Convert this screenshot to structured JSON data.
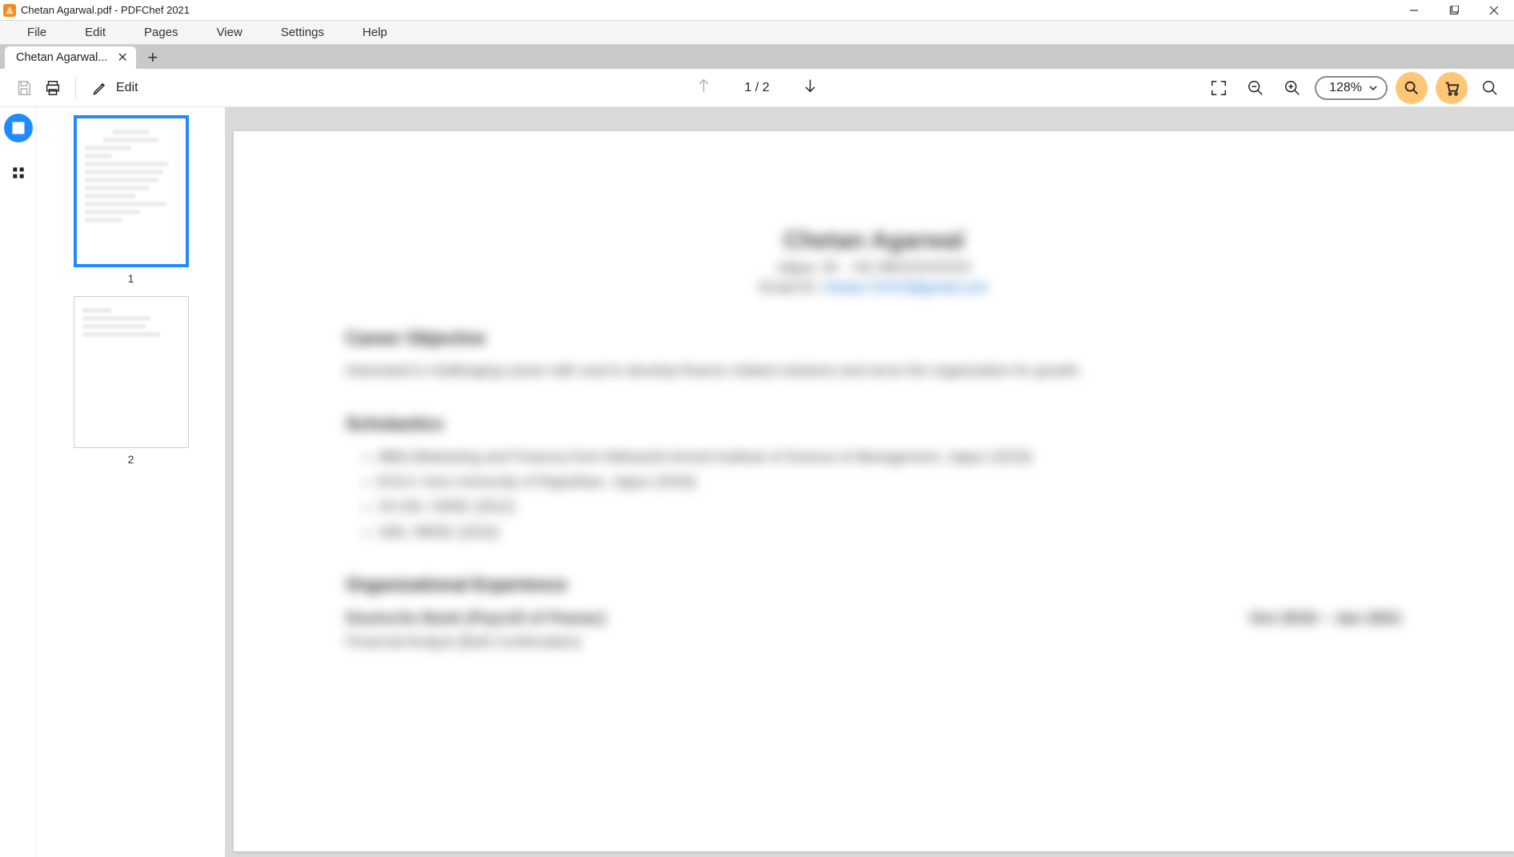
{
  "titlebar": {
    "title": "Chetan Agarwal.pdf - PDFChef 2021"
  },
  "menubar": {
    "items": [
      "File",
      "Edit",
      "Pages",
      "View",
      "Settings",
      "Help"
    ]
  },
  "tab": {
    "label": "Chetan Agarwal...",
    "close": "✕"
  },
  "toolbar": {
    "edit_label": "Edit",
    "page_indicator": "1 / 2",
    "zoom_label": "128%"
  },
  "thumbnails": {
    "pages": [
      "1",
      "2"
    ]
  },
  "document": {
    "name": "Chetan Agarwal",
    "contact_line": "Jaipur, IN  ·  +91 99XXXXXXXX",
    "email_prefix": "Email ID: ",
    "email_link": "chetan.XXXX@gmail.com",
    "section_objective": "Career Objective",
    "objective_text": "Interested in challenging career with zeal to develop finance related solutions and serve the organization for growth.",
    "section_scholastics": "Scholastics",
    "scholastics": [
      "MBA (Marketing and Finance) from Maharishi Arvind Institute of Science & Management, Jaipur (2019)",
      "B.B.A. from University of Rajasthan, Jaipur (2016)",
      "10+2th, CBSE (2012)",
      "10th, RBSE (2010)"
    ],
    "section_experience": "Organizational Experience",
    "exp_company": "Deutsche Bank (Payroll of Pamac)",
    "exp_dates": "Oct 2019 – Jan 2021",
    "exp_role": "Financial Analyst (Bulk Confirmation)"
  }
}
